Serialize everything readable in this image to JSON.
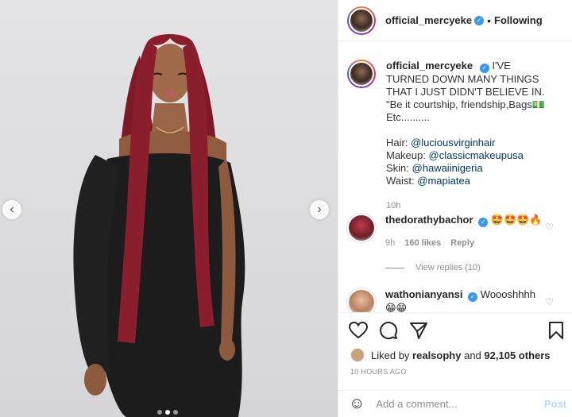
{
  "post": {
    "prev_icon": "chevron-left-icon",
    "next_icon": "chevron-right-icon",
    "carousel_dots": 3
  },
  "header": {
    "username": "official_mercyeke",
    "separator": "•",
    "follow_status": "Following"
  },
  "caption": {
    "username": "official_mercyeke",
    "text": "I'VE TURNED DOWN MANY THINGS THAT I JUST DIDN'T BELIEVE IN. \"Be it courtship, friendship,Bags💵Etc..........",
    "hair_label": "Hair:",
    "hair_mention": "@luciousvirginhair",
    "makeup_label": "Makeup:",
    "makeup_mention": "@classicmakeupusa",
    "skin_label": "Skin:",
    "skin_mention": "@hawaiinigeria",
    "waist_label": "Waist:",
    "waist_mention": "@mapiatea",
    "time": "10h"
  },
  "comments": [
    {
      "username": "thedorathybachor",
      "text": "🤩🤩🤩🔥",
      "time": "9h",
      "likes": "160 likes",
      "reply": "Reply",
      "view_replies": "View replies (10)"
    },
    {
      "username": "wathonianyansi",
      "text": "Woooshhhh",
      "emoji_line": "😁😁"
    }
  ],
  "likes": {
    "liked_by_prefix": "Liked by",
    "liked_by_user": "realsophy",
    "and": "and",
    "others": "92,105 others"
  },
  "posted_time": "10 HOURS AGO",
  "add_comment": {
    "placeholder": "Add a comment...",
    "post_label": "Post"
  },
  "colors": {
    "accent": "#3897f0",
    "link": "#00376b",
    "post_disabled": "#b3dbff",
    "hair": "#8b1e2c",
    "dress": "#1a1a1a"
  }
}
